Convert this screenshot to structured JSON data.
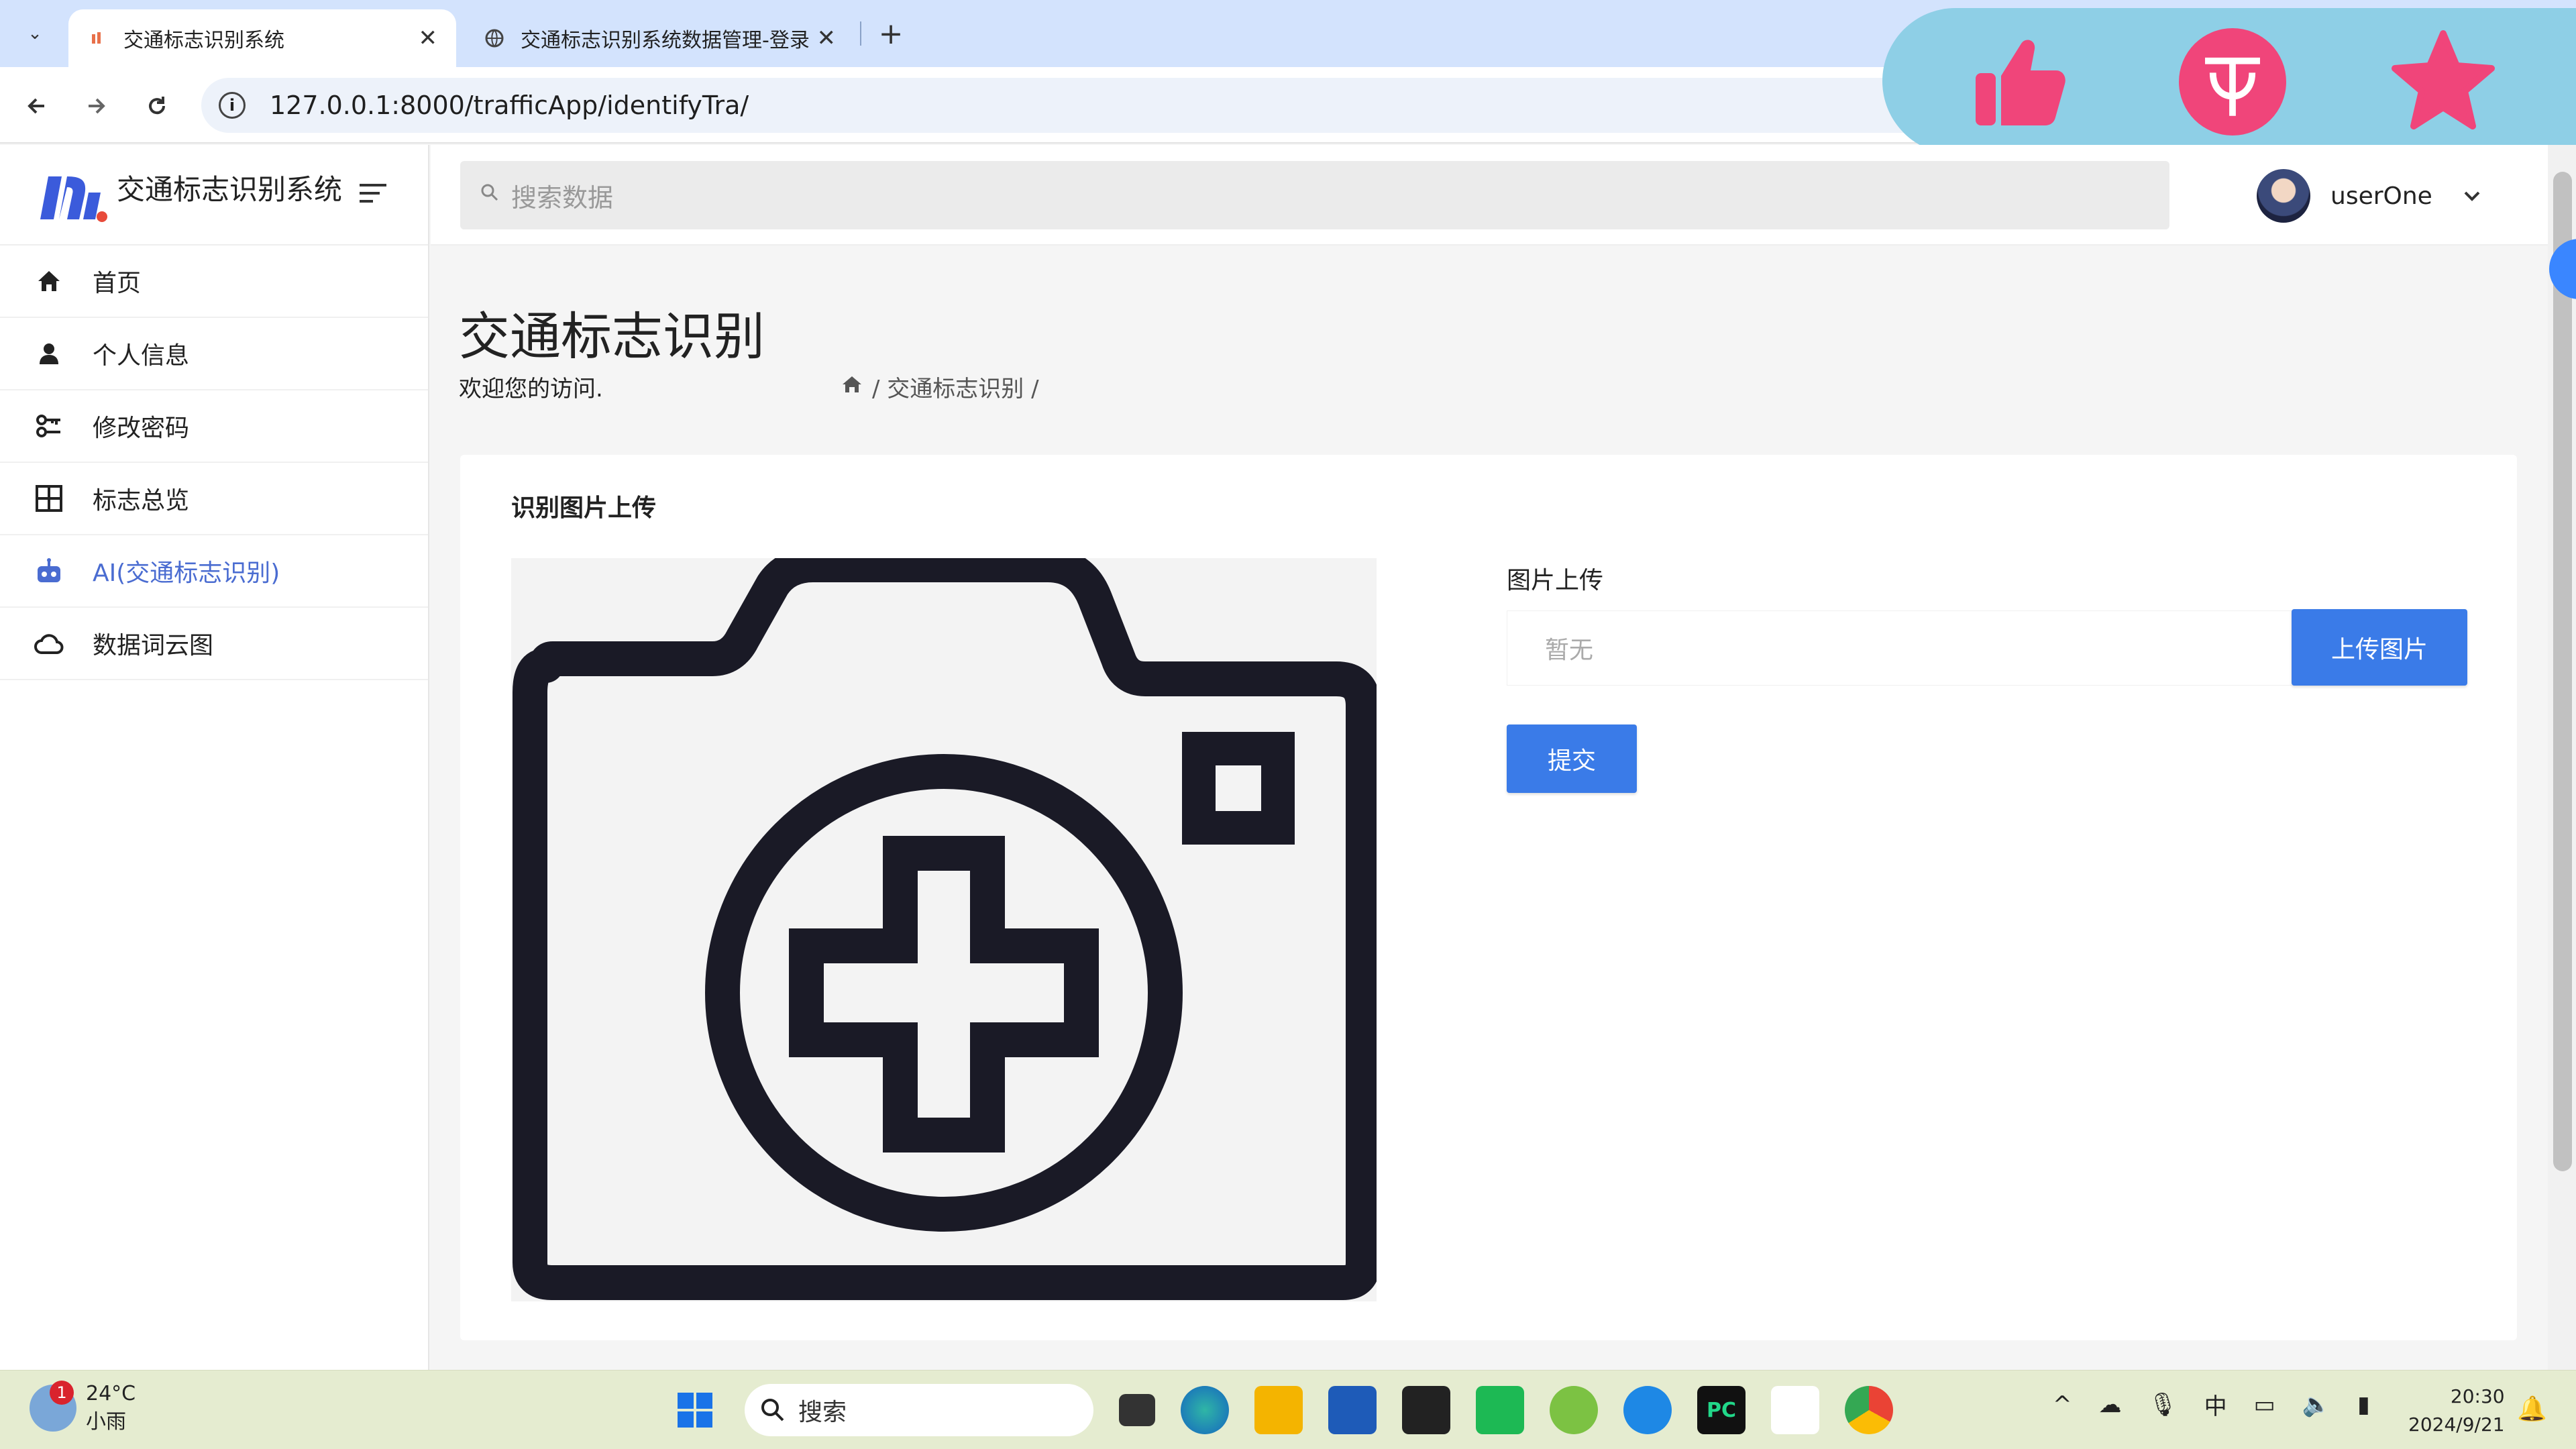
{
  "browser": {
    "tabs": [
      {
        "title": "交通标志识别系统",
        "active": true
      },
      {
        "title": "交通标志识别系统数据管理-登录",
        "active": false
      }
    ],
    "url": "127.0.0.1:8000/trafficApp/identifyTra/",
    "icons": {
      "back": "arrow-left-icon",
      "forward": "arrow-right-icon",
      "reload": "reload-icon",
      "info": "info-icon"
    }
  },
  "overlay": {
    "icons": [
      "thumbs-up-icon",
      "coin-icon",
      "star-icon"
    ],
    "colors": {
      "background": "#8ecfe6",
      "icon": "#f0457a"
    }
  },
  "sidebar": {
    "brand": "交通标志识别系统",
    "items": [
      {
        "label": "首页",
        "icon": "home-icon"
      },
      {
        "label": "个人信息",
        "icon": "user-icon"
      },
      {
        "label": "修改密码",
        "icon": "key-icon"
      },
      {
        "label": "标志总览",
        "icon": "grid-icon"
      },
      {
        "label": "AI(交通标志识别)",
        "icon": "robot-icon",
        "active": true
      },
      {
        "label": "数据词云图",
        "icon": "cloud-icon"
      }
    ]
  },
  "header": {
    "search_placeholder": "搜索数据",
    "username": "userOne"
  },
  "main": {
    "title": "交通标志识别",
    "welcome": "欢迎您的访问.",
    "breadcrumb": "/ 交通标志识别 /",
    "card_title": "识别图片上传",
    "field_label": "图片上传",
    "file_value": "暂无",
    "upload_button": "上传图片",
    "submit_button": "提交",
    "accent": "#3a7be8"
  },
  "taskbar": {
    "weather_temp": "24°C",
    "weather_desc": "小雨",
    "weather_badge": "1",
    "search_label": "搜索",
    "ime": "中",
    "time": "20:30",
    "date": "2024/9/21"
  }
}
